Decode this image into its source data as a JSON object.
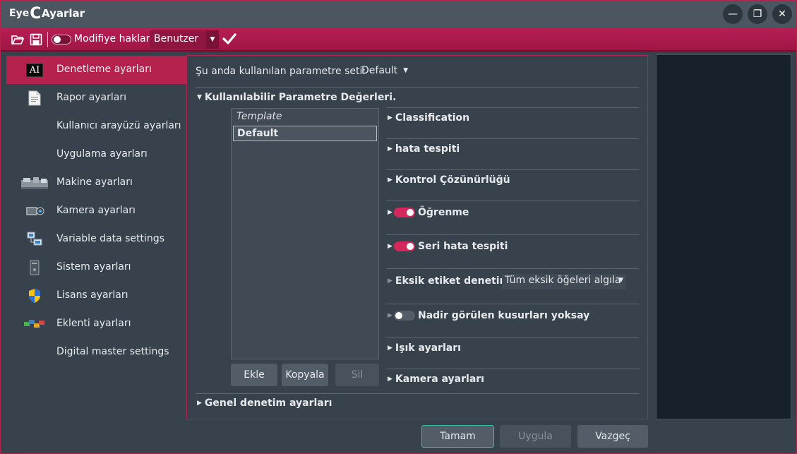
{
  "window": {
    "title": "Ayarlar",
    "logo_text": "Eye",
    "logo_c": "C",
    "minimize_glyph": "—",
    "restore_glyph": "❐",
    "close_glyph": "✕"
  },
  "toolbar": {
    "modify_label": "Modifiye hakları",
    "user_combo_value": "Benutzer",
    "combo_arrow": "▼"
  },
  "sidebar": {
    "items": [
      {
        "label": "Denetleme ayarları",
        "icon": "ai-icon",
        "icon_text": "AI"
      },
      {
        "label": "Rapor ayarları",
        "icon": "report-icon"
      },
      {
        "label": "Kullanıcı arayüzü ayarları",
        "icon": ""
      },
      {
        "label": "Uygulama ayarları",
        "icon": ""
      },
      {
        "label": "Makine ayarları",
        "icon": "machine-icon"
      },
      {
        "label": "Kamera ayarları",
        "icon": "camera-icon"
      },
      {
        "label": "Variable data settings",
        "icon": "network-icon"
      },
      {
        "label": "Sistem ayarları",
        "icon": "system-icon"
      },
      {
        "label": "Lisans ayarları",
        "icon": "shield-icon"
      },
      {
        "label": "Eklenti ayarları",
        "icon": "plugin-icon"
      },
      {
        "label": "Digital master settings",
        "icon": ""
      }
    ]
  },
  "main": {
    "current_param_label": "Şu anda kullanılan parametre seti:",
    "current_param_value": "Default",
    "available_header": "Kullanılabilir Parametre Değerleri.",
    "list_items": [
      "Template",
      "Default"
    ],
    "buttons": {
      "add": "Ekle",
      "copy": "Kopyala",
      "delete": "Sil"
    },
    "sections": {
      "classification": "Classification",
      "defect_detection": "hata tespiti",
      "control_resolution": "Kontrol Çözünürlüğü",
      "learning": "Öğrenme",
      "serial_defect": "Seri hata tespiti",
      "missing_label": "Eksik etiket denetimi",
      "missing_label_combo": "Tüm eksik öğeleri algıla",
      "ignore_rare": "Nadir görülen kusurları yoksay",
      "light": "Işık ayarları",
      "camera": "Kamera ayarları",
      "general": "Genel denetim ayarları"
    },
    "caret_down": "▼",
    "caret_right": "▶"
  },
  "footer": {
    "ok": "Tamam",
    "apply": "Uygula",
    "cancel": "Vazgeç"
  },
  "colors": {
    "accent": "#b5224d",
    "toggle_on": "#d4285d",
    "primary_border": "#2fc1a2",
    "background": "#37424c"
  }
}
